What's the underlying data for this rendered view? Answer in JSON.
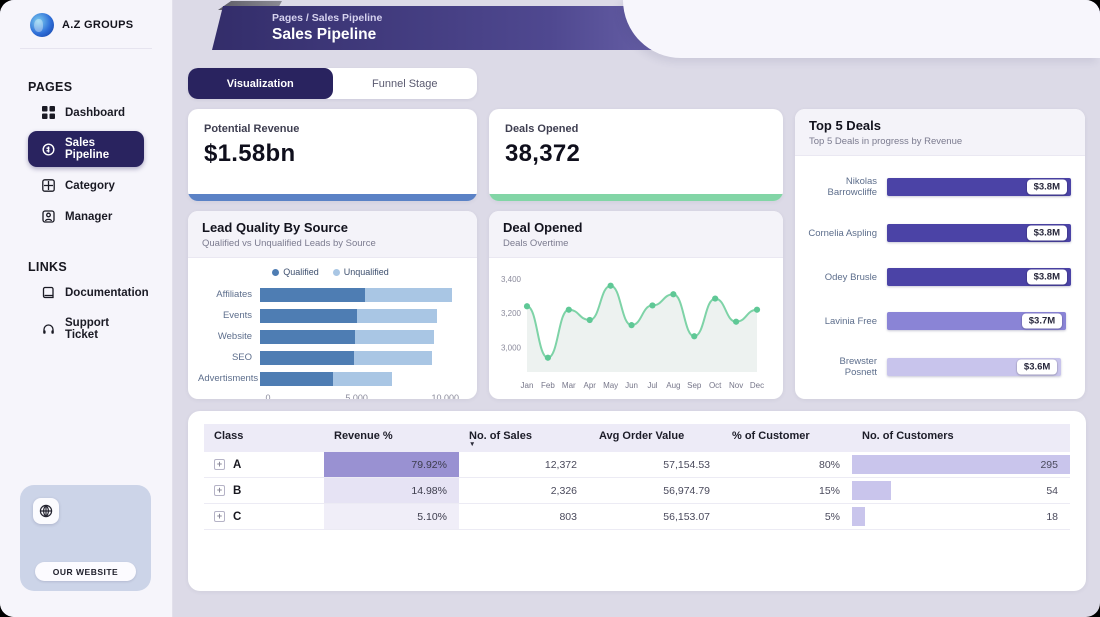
{
  "sidebar": {
    "brand": "A.Z GROUPS",
    "sections": [
      {
        "heading": "PAGES",
        "items": [
          {
            "label": "Dashboard",
            "icon": "dashboard-icon",
            "active": false
          },
          {
            "label": "Sales Pipeline",
            "icon": "sales-pipeline-icon",
            "active": true
          },
          {
            "label": "Category",
            "icon": "category-icon",
            "active": false
          },
          {
            "label": "Manager",
            "icon": "manager-icon",
            "active": false
          }
        ]
      },
      {
        "heading": "LINKS",
        "items": [
          {
            "label": "Documentation",
            "icon": "documentation-icon",
            "active": false
          },
          {
            "label": "Support Ticket",
            "icon": "support-ticket-icon",
            "active": false
          }
        ]
      }
    ],
    "promo": {
      "icon": "globe-icon",
      "website_button": "OUR WEBSITE"
    }
  },
  "header": {
    "breadcrumb": "Pages / Sales Pipeline",
    "title": "Sales Pipeline"
  },
  "tabs": [
    {
      "label": "Visualization",
      "active": true
    },
    {
      "label": "Funnel Stage",
      "active": false
    }
  ],
  "kpis": [
    {
      "label": "Potential Revenue",
      "value": "$1.58bn",
      "accent": "#5b82c6"
    },
    {
      "label": "Deals Opened",
      "value": "38,372",
      "accent": "#82d5a6"
    }
  ],
  "chart_data": [
    {
      "id": "lead_quality",
      "type": "bar",
      "orientation": "horizontal",
      "stacked": true,
      "title": "Lead Quality By Source",
      "subtitle": "Qualified vs Unqualified Leads by Source",
      "legend_position": "top",
      "categories": [
        "Affiliates",
        "Events",
        "Website",
        "SEO",
        "Advertisments"
      ],
      "series": [
        {
          "name": "Qualified",
          "color": "#4e7db3",
          "values": [
            5700,
            5250,
            5150,
            5080,
            3960
          ]
        },
        {
          "name": "Unqualified",
          "color": "#a9c6e4",
          "values": [
            4700,
            4350,
            4280,
            4220,
            3200
          ]
        }
      ],
      "xticks": [
        "0",
        "5,000",
        "10,000"
      ],
      "xtick_values": [
        0,
        5000,
        10000
      ],
      "xmax": 11000,
      "grid": false
    },
    {
      "id": "deals_overtime",
      "type": "line",
      "title": "Deal Opened",
      "subtitle": "Deals Overtime",
      "x": [
        "Jan",
        "Feb",
        "Mar",
        "Apr",
        "May",
        "Jun",
        "Jul",
        "Aug",
        "Sep",
        "Oct",
        "Nov",
        "Dec"
      ],
      "values": [
        3240,
        2940,
        3220,
        3160,
        3360,
        3130,
        3245,
        3310,
        3065,
        3285,
        3150,
        3220
      ],
      "yticks": [
        "3,400",
        "3,200",
        "3,000"
      ],
      "ytick_values": [
        3400,
        3200,
        3000
      ],
      "ylim": [
        2880,
        3440
      ],
      "line_color": "#7ed3a7",
      "dot_color": "#5fc896",
      "area_color": "#edf2f0",
      "grid": false
    },
    {
      "id": "top_deals",
      "type": "bar",
      "orientation": "horizontal",
      "title": "Top 5 Deals",
      "subtitle": "Top 5 Deals in progress by Revenue",
      "categories": [
        "Nikolas Barrowcliffe",
        "Cornelia Aspling",
        "Odey Brusle",
        "Lavinia Free",
        "Brewster Posnett"
      ],
      "values": [
        3.8,
        3.8,
        3.8,
        3.7,
        3.6
      ],
      "labels": [
        "$3.8M",
        "$3.8M",
        "$3.8M",
        "$3.7M",
        "$3.6M"
      ],
      "bar_colors": [
        "#4b43a6",
        "#4b43a6",
        "#4b43a6",
        "#8a84d6",
        "#c8c4ec"
      ],
      "xmax": 3.8,
      "grid": false
    },
    {
      "id": "class_table",
      "type": "table",
      "columns": [
        "Class",
        "Revenue %",
        "No. of Sales",
        "Avg Order Value",
        "% of Customer",
        "No. of Customers"
      ],
      "sort_column": "No. of Sales",
      "expand_glyph": "+",
      "bar_color": "#c9c5ec",
      "rows": [
        {
          "class": "A",
          "revenue_pct": "79.92%",
          "revenue_fill": "#9991d2",
          "sales": "12,372",
          "avg_order": "57,154.53",
          "customer_pct": "80%",
          "customers": "295",
          "customers_bar": 1.0
        },
        {
          "class": "B",
          "revenue_pct": "14.98%",
          "revenue_fill": "#e6e3f4",
          "sales": "2,326",
          "avg_order": "56,974.79",
          "customer_pct": "15%",
          "customers": "54",
          "customers_bar": 0.18
        },
        {
          "class": "C",
          "revenue_pct": "5.10%",
          "revenue_fill": "#f0eef8",
          "sales": "803",
          "avg_order": "56,153.07",
          "customer_pct": "5%",
          "customers": "18",
          "customers_bar": 0.06
        }
      ]
    }
  ]
}
